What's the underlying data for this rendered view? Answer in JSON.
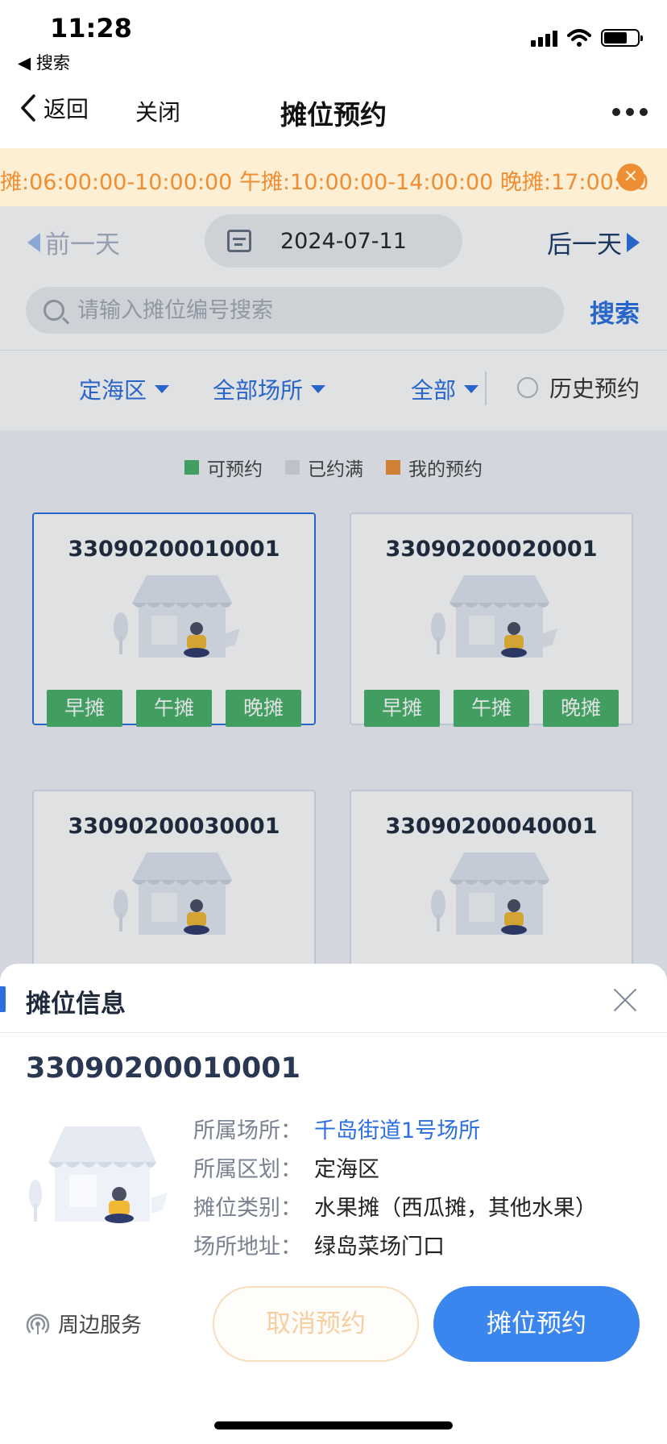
{
  "status_bar": {
    "time": "11:28",
    "back_label": "◀ 搜索"
  },
  "nav": {
    "back_label": "返回",
    "close_label": "关闭",
    "title": "摊位预约"
  },
  "notice": {
    "text": "摊:06:00:00-10:00:00 午摊:10:00:00-14:00:00 晚摊:17:00:00"
  },
  "date_bar": {
    "prev_label": "前一天",
    "date": "2024-07-11",
    "next_label": "后一天"
  },
  "search": {
    "placeholder": "请输入摊位编号搜索",
    "button_label": "搜索"
  },
  "filters": {
    "district": "定海区",
    "venue": "全部场所",
    "status": "全部",
    "history_label": "历史预约"
  },
  "legend": [
    {
      "label": "可预约",
      "color": "#48b267"
    },
    {
      "label": "已约满",
      "color": "#d9dbe0"
    },
    {
      "label": "我的预约",
      "color": "#ef8d33"
    }
  ],
  "stalls": [
    {
      "code": "33090200010001",
      "slots": [
        "早摊",
        "午摊",
        "晚摊"
      ]
    },
    {
      "code": "33090200020001",
      "slots": [
        "早摊",
        "午摊",
        "晚摊"
      ]
    },
    {
      "code": "33090200030001",
      "slots": []
    },
    {
      "code": "33090200040001",
      "slots": []
    }
  ],
  "sheet": {
    "title": "摊位信息",
    "code": "33090200010001",
    "info": [
      {
        "label": "所属场所：",
        "value": "千岛街道1号场所"
      },
      {
        "label": "所属区划：",
        "value": "定海区"
      },
      {
        "label": "摊位类别：",
        "value": "水果摊（西瓜摊，其他水果）"
      },
      {
        "label": "场所地址：",
        "value": "绿岛菜场门口"
      }
    ],
    "nearby_label": "周边服务",
    "cancel_label": "取消预约",
    "reserve_label": "摊位预约"
  },
  "colors": {
    "accent": "#2b6fe0",
    "available": "#48b267",
    "notice_bg": "#fdefd4",
    "notice_text": "#ef8d33"
  }
}
